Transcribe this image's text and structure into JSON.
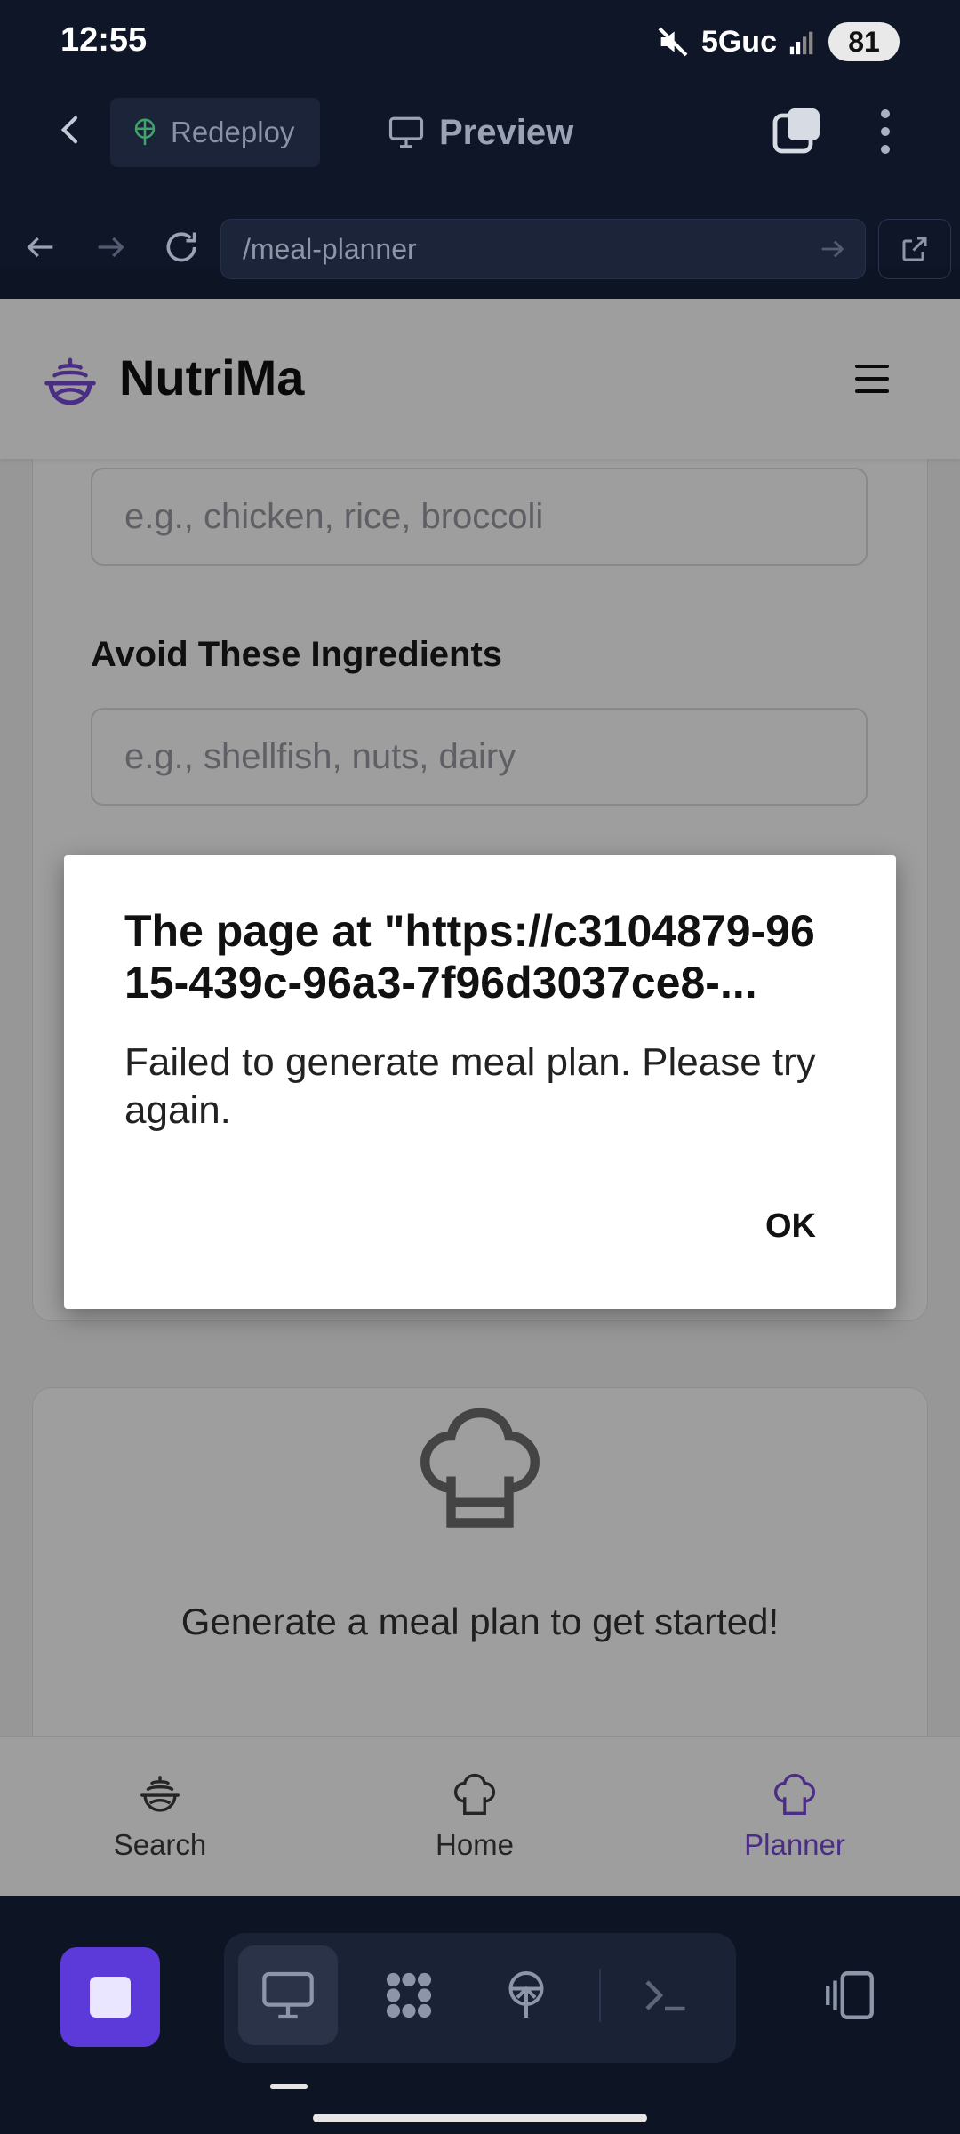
{
  "status_bar": {
    "time": "12:55",
    "network": "5Guc",
    "battery": "81"
  },
  "editor": {
    "redeploy_label": "Redeploy",
    "preview_label": "Preview"
  },
  "browser": {
    "url": "/meal-planner"
  },
  "app": {
    "brand": "NutriMa",
    "form": {
      "include_placeholder": "e.g., chicken, rice, broccoli",
      "avoid_label": "Avoid These Ingredients",
      "avoid_placeholder": "e.g., shellfish, nuts, dairy"
    },
    "empty_state": "Generate a meal plan to get started!",
    "bottom_nav": [
      {
        "label": "Search",
        "icon": "search-dish-icon"
      },
      {
        "label": "Home",
        "icon": "chef-hat-icon"
      },
      {
        "label": "Planner",
        "icon": "chef-hat-icon",
        "active": true
      }
    ]
  },
  "dialog": {
    "title": "The page at \"https://c3104879-9615-439c-96a3-7f96d3037ce8-...",
    "message": "Failed to generate meal plan. Please try again.",
    "ok_label": "OK"
  },
  "colors": {
    "accent": "#7b4ad9",
    "dark_bg": "#0f1628",
    "stop_button": "#5b3ad9"
  }
}
